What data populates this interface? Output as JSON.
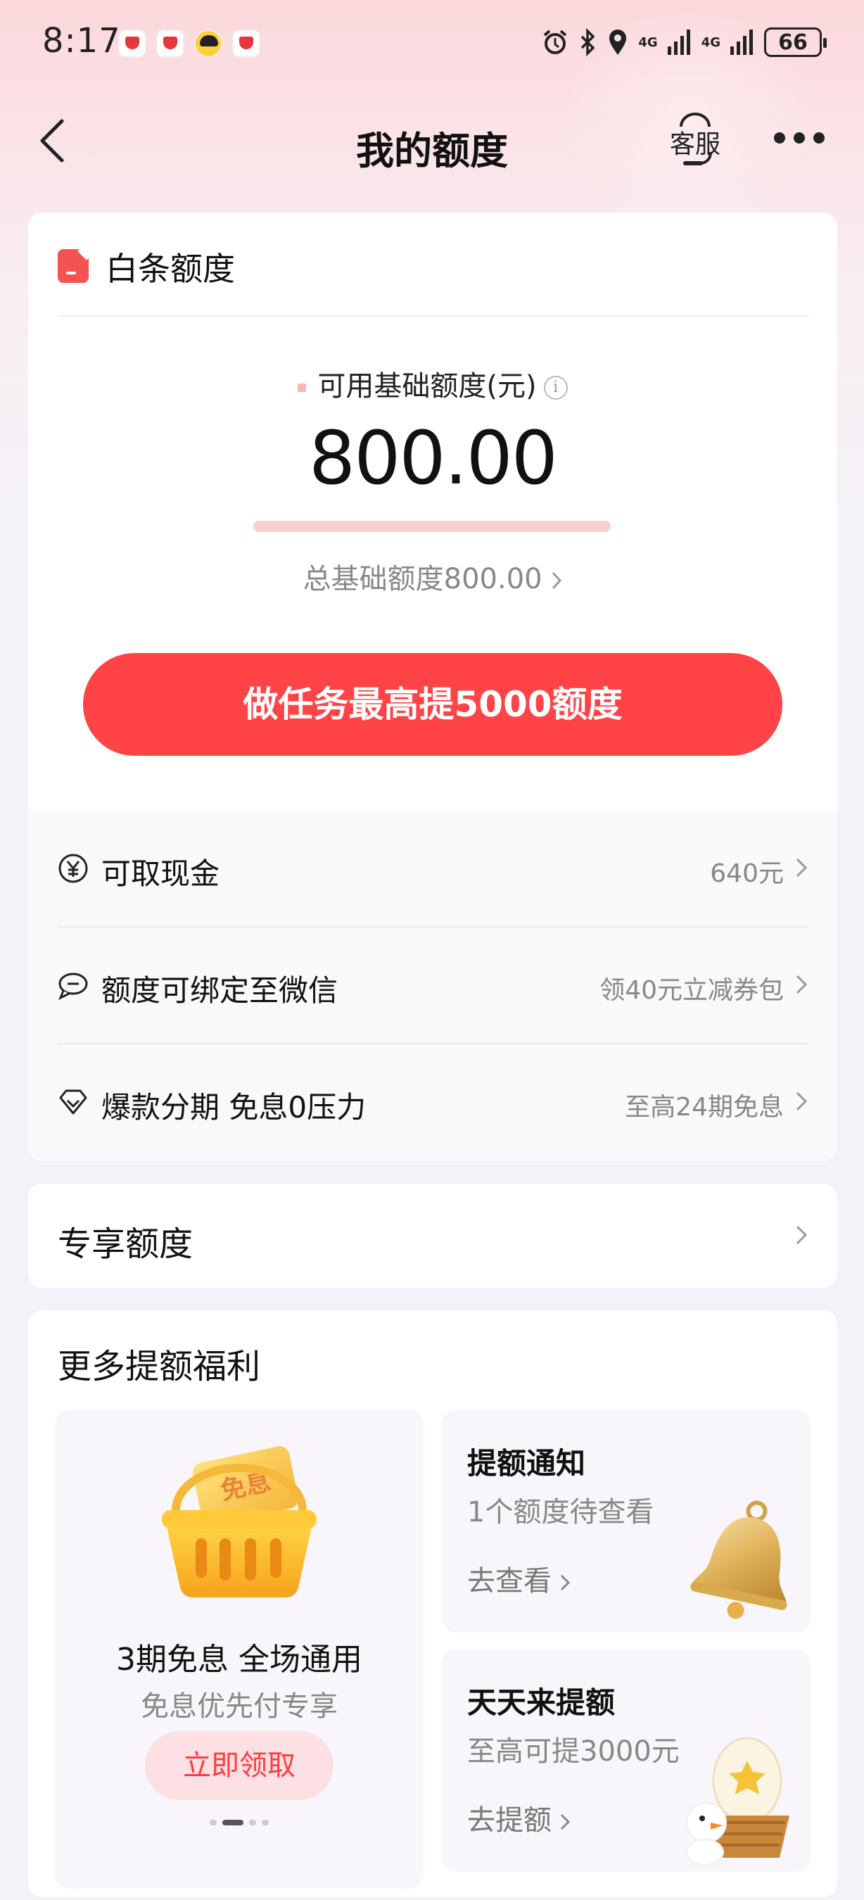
{
  "status_bar": {
    "time": "8:17",
    "battery": "66",
    "network": "4G"
  },
  "nav": {
    "title": "我的额度",
    "customer_service": "客服"
  },
  "quota_card": {
    "title": "白条额度",
    "available_label": "可用基础额度(元)",
    "available_amount": "800.00",
    "used_fraction": 0,
    "total_label": "总基础额度800.00",
    "cta_label": "做任务最高提5000额度",
    "perks": [
      {
        "label": "可取现金",
        "value": "640元",
        "icon": "yuan-icon"
      },
      {
        "label": "额度可绑定至微信",
        "value": "领40元立减券包",
        "icon": "chat-icon"
      },
      {
        "label": "爆款分期 免息0压力",
        "value": "至高24期免息",
        "icon": "diamond-icon"
      }
    ]
  },
  "exclusive": {
    "title": "专享额度"
  },
  "more_benefits": {
    "title": "更多提额福利",
    "promo": {
      "badge": "免息",
      "title": "3期免息 全场通用",
      "subtitle": "免息优先付专享",
      "button": "立即领取"
    },
    "cards": [
      {
        "title": "提额通知",
        "subtitle": "1个额度待查看",
        "link": "去查看"
      },
      {
        "title": "天天来提额",
        "subtitle": "至高可提3000元",
        "link": "去提额"
      }
    ]
  },
  "colors": {
    "accent": "#ff4346",
    "promo_button_bg": "#fde0e3"
  }
}
